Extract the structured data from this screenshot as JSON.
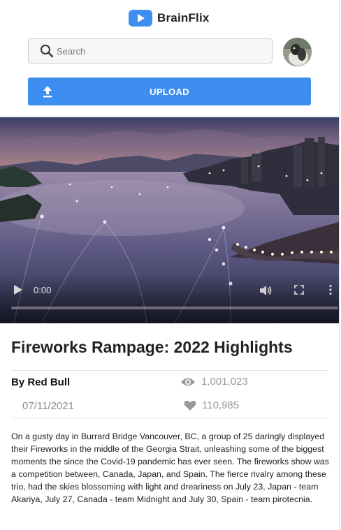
{
  "header": {
    "brand_name": "BrainFlix",
    "brand_color": "#3d8ef0",
    "logo_icon": "play-icon",
    "search_placeholder": "Search",
    "search_value": "",
    "upload_label": "UPLOAD",
    "upload_icon": "upload-icon",
    "avatar_icon": "user-avatar"
  },
  "video": {
    "current_time": "0:00",
    "progress": 0,
    "controls": [
      "play-icon",
      "volume-icon",
      "fullscreen-icon",
      "more-icon"
    ]
  },
  "details": {
    "title": "Fireworks Rampage: 2022 Highlights",
    "author": "By Red Bull",
    "date": "07/11/2021",
    "views": "1,001,023",
    "likes": "110,985",
    "views_icon": "eye-icon",
    "likes_icon": "heart-icon",
    "description": "On a gusty day in Burrard Bridge Vancouver, BC, a group of 25 daringly displayed their Fireworks in the middle of the Georgia Strait, unleashing some of the biggest moments the since the Covid-19 pandemic has ever seen. The fireworks show was a competition between, Canada, Japan, and Spain. The fierce rivalry among these trio, had the skies blossoming with light and dreariness on July 23, Japan - team Akariya, July 27, Canada - team Midnight and July 30, Spain - team pirotecnia."
  }
}
